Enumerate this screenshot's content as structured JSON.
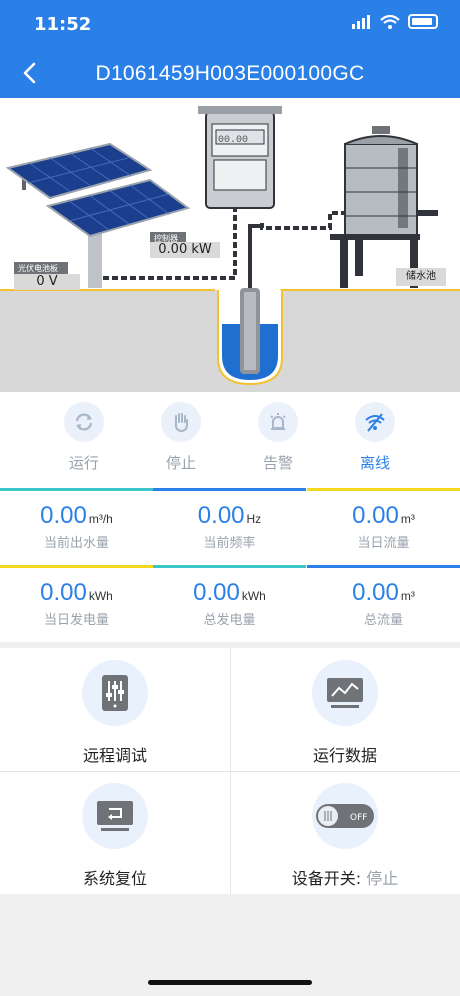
{
  "status_bar": {
    "time": "11:52"
  },
  "header": {
    "title": "D1061459H003E000100GC"
  },
  "scene": {
    "panel_label": "光伏电池板",
    "panel_value": "0 V",
    "controller_label": "控制器",
    "controller_value": "0.00 kW",
    "meter_display": "00.00",
    "tank_label": "储水池"
  },
  "status": [
    {
      "label": "运行",
      "icon": "refresh-icon",
      "active": false
    },
    {
      "label": "停止",
      "icon": "hand-icon",
      "active": false
    },
    {
      "label": "告警",
      "icon": "alarm-icon",
      "active": false
    },
    {
      "label": "离线",
      "icon": "wifi-off-icon",
      "active": true
    }
  ],
  "metrics": [
    {
      "value": "0.00",
      "unit": "m³/h",
      "label": "当前出水量"
    },
    {
      "value": "0.00",
      "unit": "Hz",
      "label": "当前频率"
    },
    {
      "value": "0.00",
      "unit": "m³",
      "label": "当日流量"
    },
    {
      "value": "0.00",
      "unit": "kWh",
      "label": "当日发电量"
    },
    {
      "value": "0.00",
      "unit": "kWh",
      "label": "总发电量"
    },
    {
      "value": "0.00",
      "unit": "m³",
      "label": "总流量"
    }
  ],
  "colors": {
    "accent": "#2b80e8",
    "teal": "#3cc6c8",
    "yellow": "#f5d71e",
    "muted": "#9aa3ad"
  },
  "actions": {
    "remote_debug": "远程调试",
    "run_data": "运行数据",
    "system_reset": "系统复位",
    "device_switch_label": "设备开关:",
    "device_switch_state": "停止",
    "toggle_text": "OFF"
  }
}
